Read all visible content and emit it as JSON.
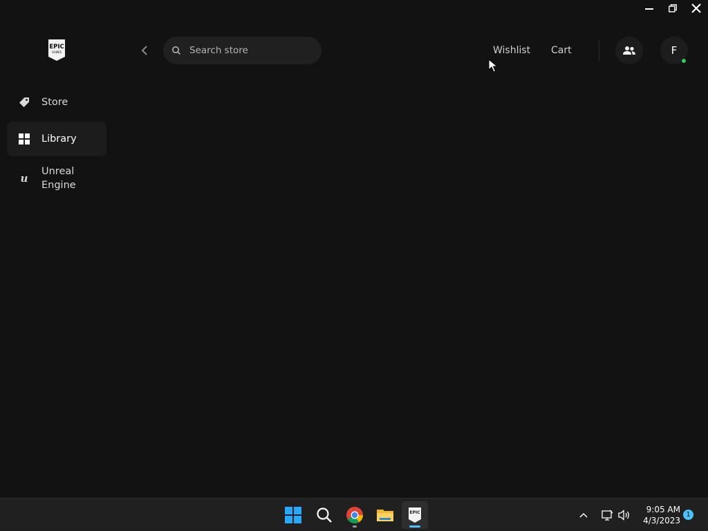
{
  "window": {
    "controls": [
      "minimize",
      "restore",
      "close"
    ]
  },
  "header": {
    "search": {
      "placeholder": "Search store"
    },
    "links": {
      "wishlist": "Wishlist",
      "cart": "Cart"
    },
    "avatar_initial": "F",
    "online_status_color": "#34c759"
  },
  "logo": {
    "top": "EPIC",
    "bottom": "GAMES"
  },
  "sidebar": {
    "items": [
      {
        "label": "Store",
        "icon": "tag-icon",
        "active": false
      },
      {
        "label": "Library",
        "icon": "grid-icon",
        "active": true
      },
      {
        "label_line1": "Unreal",
        "label_line2": "Engine",
        "icon": "unreal-engine-icon",
        "active": false
      }
    ]
  },
  "taskbar": {
    "apps": [
      "windows-start-icon",
      "search-icon",
      "chrome-icon",
      "file-explorer-icon",
      "epic-games-icon"
    ],
    "active_app": "epic-games-icon",
    "clock": {
      "time": "9:05 AM",
      "date": "4/3/2023"
    },
    "notifications": "1",
    "accent": "#4cc2ff"
  },
  "colors": {
    "background": "#121212",
    "accent": "#4cc2ff"
  }
}
